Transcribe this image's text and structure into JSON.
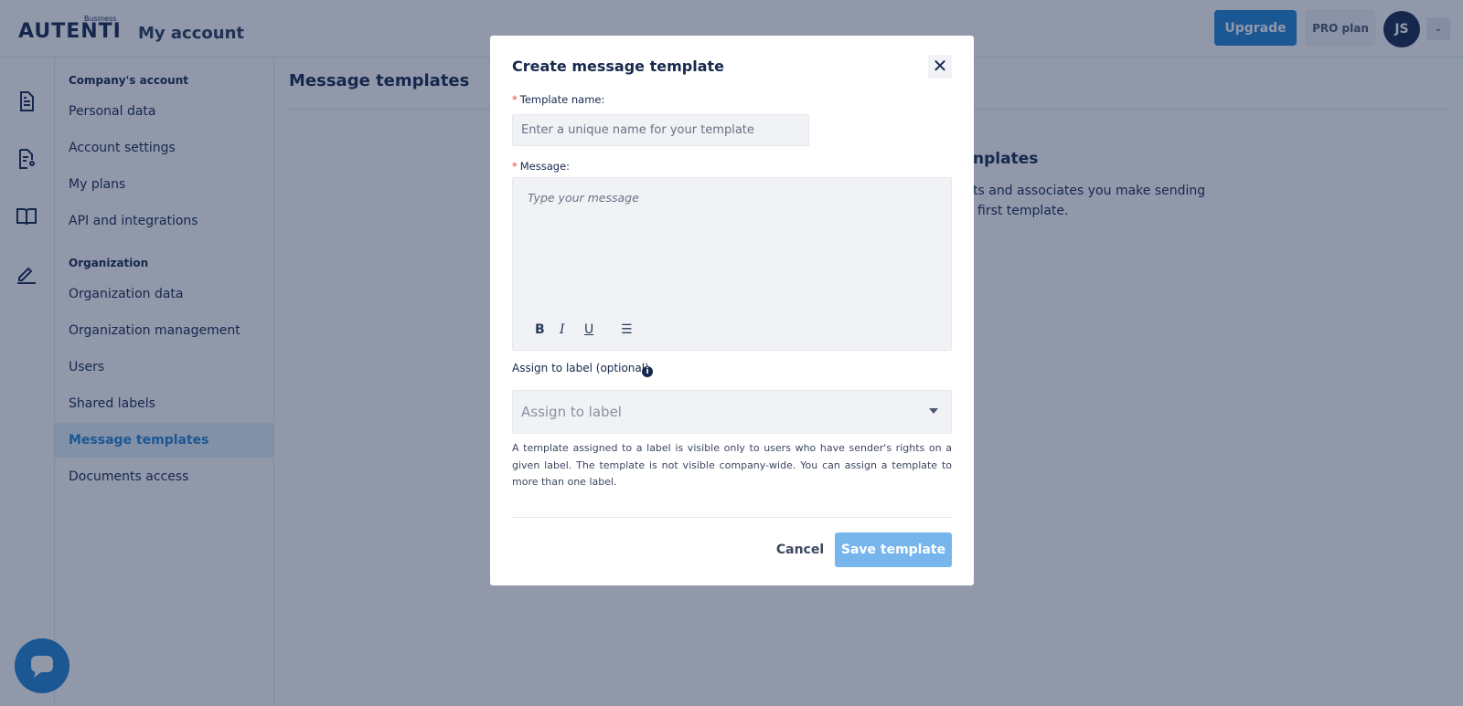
{
  "header": {
    "logo": "AUTENTI",
    "logo_sub": "Business",
    "title": "My account",
    "upgrade": "Upgrade",
    "plan": "PRO plan",
    "avatar": "JS"
  },
  "sidebar": {
    "sections": [
      {
        "title": "Company's account",
        "items": [
          "Personal data",
          "Account settings",
          "My plans",
          "API and integrations"
        ]
      },
      {
        "title": "Organization",
        "items": [
          "Organization data",
          "Organization management",
          "Users",
          "Shared labels",
          "Message templates",
          "Documents access"
        ]
      }
    ],
    "active": "Message templates"
  },
  "main": {
    "title": "Message templates",
    "empty_title_fragment": "nplates",
    "empty_text_fragments": [
      "ts and associates you make sending",
      "first template."
    ]
  },
  "modal": {
    "title": "Create message template",
    "name_label": "Template name:",
    "name_placeholder": "Enter a unique name for your template",
    "message_label": "Message:",
    "message_placeholder": "Type your message",
    "toolbar": {
      "bold": "B",
      "italic": "I",
      "underline": "U",
      "list": "☰"
    },
    "label_label": "Assign to label (optional)",
    "label_placeholder": "Assign to label",
    "hint": "A template assigned to a label is visible only to users who have sender's rights on a given label. The template is not visible company-wide. You can assign a template to more than one label.",
    "cancel": "Cancel",
    "save": "Save template"
  },
  "colors": {
    "accent": "#1f83d4",
    "text": "#16284d",
    "overlay": "rgba(22,40,77,0.48)"
  }
}
